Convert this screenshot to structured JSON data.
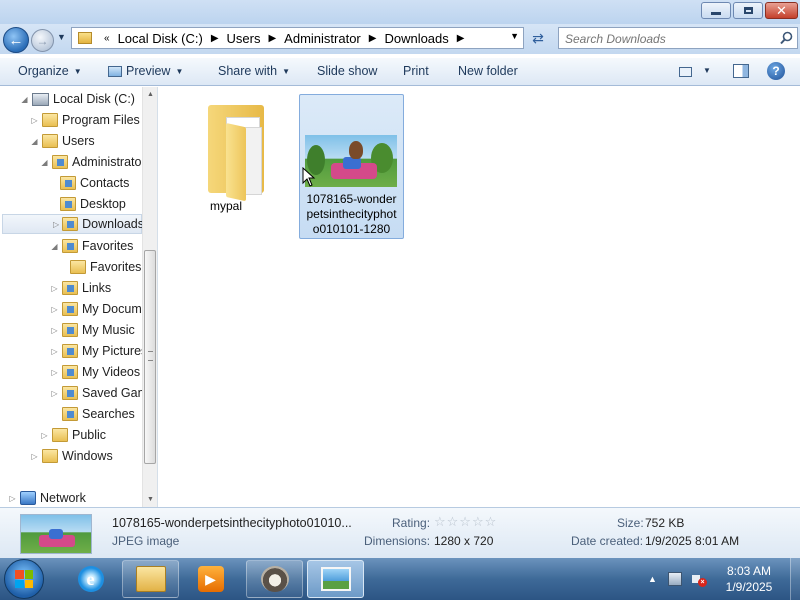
{
  "window": {
    "controls": {
      "minimize": "minimize",
      "maximize": "maximize",
      "close": "✕"
    }
  },
  "nav": {
    "breadcrumb": [
      "Local Disk (C:)",
      "Users",
      "Administrator",
      "Downloads"
    ],
    "search_placeholder": "Search Downloads"
  },
  "toolbar": {
    "items": [
      "Organize",
      "Preview",
      "Share with",
      "Slide show",
      "Print",
      "New folder"
    ]
  },
  "sidebar": {
    "items": [
      {
        "label": "Local Disk (C:)",
        "icon": "drive-icon"
      },
      {
        "label": "Program Files",
        "icon": "folder-icon"
      },
      {
        "label": "Users",
        "icon": "folder-icon"
      },
      {
        "label": "Administrato",
        "icon": "user-folder-icon"
      },
      {
        "label": "Contacts",
        "icon": "contacts-folder-icon"
      },
      {
        "label": "Desktop",
        "icon": "desktop-folder-icon"
      },
      {
        "label": "Downloads",
        "icon": "downloads-folder-icon"
      },
      {
        "label": "Favorites",
        "icon": "favorites-folder-icon"
      },
      {
        "label": "Favorites",
        "icon": "folder-icon"
      },
      {
        "label": "Links",
        "icon": "links-folder-icon"
      },
      {
        "label": "My Docum",
        "icon": "documents-folder-icon"
      },
      {
        "label": "My Music",
        "icon": "music-folder-icon"
      },
      {
        "label": "My Pictures",
        "icon": "pictures-folder-icon"
      },
      {
        "label": "My Videos",
        "icon": "videos-folder-icon"
      },
      {
        "label": "Saved Gam",
        "icon": "saved-games-folder-icon"
      },
      {
        "label": "Searches",
        "icon": "searches-folder-icon"
      },
      {
        "label": "Public",
        "icon": "folder-icon"
      },
      {
        "label": "Windows",
        "icon": "folder-icon"
      },
      {
        "label": "Network",
        "icon": "network-icon"
      }
    ],
    "selected": "Downloads"
  },
  "files": [
    {
      "name": "mypal",
      "type": "folder"
    },
    {
      "name_lines": [
        "1078165-wonder",
        "petsinthecityphot",
        "o010101-1280"
      ],
      "type": "jpeg",
      "selected": true
    }
  ],
  "details": {
    "filename": "1078165-wonderpetsinthecityphoto01010...",
    "filetype": "JPEG image",
    "rating_label": "Rating:",
    "rating_stars": "☆☆☆☆☆",
    "rating_value": 0,
    "dimensions_label": "Dimensions:",
    "dimensions_value": "1280 x 720",
    "size_label": "Size:",
    "size_value": "752 KB",
    "date_label": "Date created:",
    "date_value": "1/9/2025 8:01 AM"
  },
  "taskbar": {
    "apps": [
      "start-button",
      "internet-explorer",
      "windows-explorer",
      "media-player",
      "raccoon-app",
      "image-viewer"
    ],
    "time": "8:03 AM",
    "date": "1/9/2025"
  },
  "colors": {
    "selection": "#cce1f6",
    "selection_border": "#84acdd",
    "taskbar": "#3e6a98"
  }
}
